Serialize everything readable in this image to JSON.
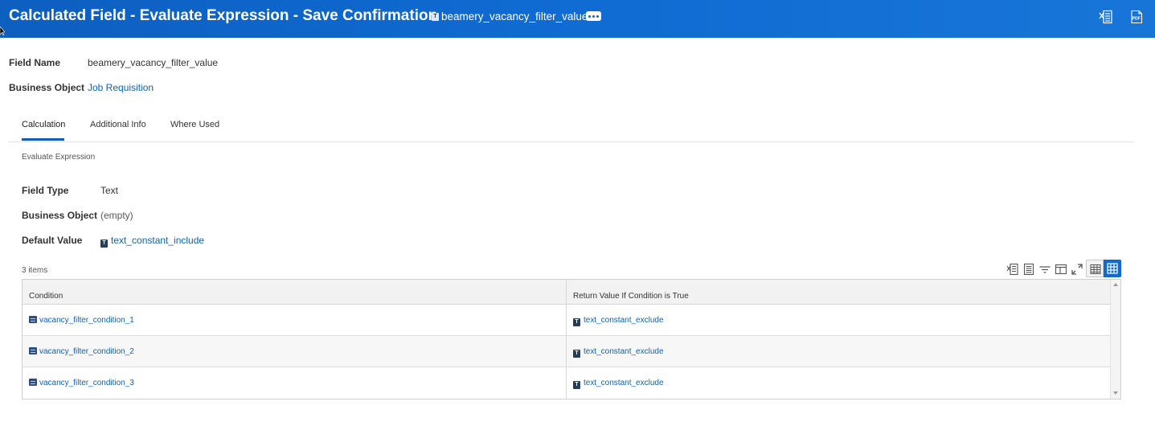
{
  "header": {
    "title": "Calculated Field - Evaluate Expression - Save Confirmation",
    "object_badge": "T",
    "object_name": "beamery_vacancy_filter_value",
    "pdf_label": "PDF"
  },
  "fields": {
    "field_name_label": "Field Name",
    "field_name_value": "beamery_vacancy_filter_value",
    "business_object_label": "Business Object",
    "business_object_value": "Job Requisition"
  },
  "tabs": [
    {
      "label": "Calculation",
      "active": true
    },
    {
      "label": "Additional Info",
      "active": false
    },
    {
      "label": "Where Used",
      "active": false
    }
  ],
  "calculation": {
    "section_title": "Evaluate Expression",
    "field_type_label": "Field Type",
    "field_type_value": "Text",
    "business_object_label": "Business Object",
    "business_object_value": "(empty)",
    "default_value_label": "Default Value",
    "default_value_badge": "T",
    "default_value": "text_constant_include"
  },
  "table": {
    "items_count": "3 items",
    "columns": [
      "Condition",
      "Return Value If Condition is True"
    ],
    "rows": [
      {
        "condition": "vacancy_filter_condition_1",
        "badge": "T",
        "return_value": "text_constant_exclude"
      },
      {
        "condition": "vacancy_filter_condition_2",
        "badge": "T",
        "return_value": "text_constant_exclude"
      },
      {
        "condition": "vacancy_filter_condition_3",
        "badge": "T",
        "return_value": "text_constant_exclude"
      }
    ]
  },
  "colors": {
    "header_blue": "#0f6ad1",
    "link_blue": "#0b63b8",
    "active_tab": "#0f5fb6"
  }
}
